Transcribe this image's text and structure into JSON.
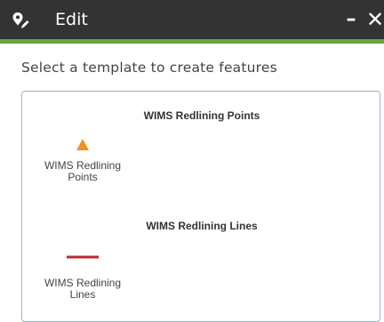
{
  "header": {
    "title": "Edit",
    "minimize_glyph": "–",
    "close_glyph": "✕",
    "background": "#333333",
    "accent": "#6aa43a"
  },
  "instructions": "Select a template to create features",
  "groups": [
    {
      "title": "WIMS Redlining Points",
      "items": [
        {
          "label": "WIMS Redlining Points",
          "symbol": "triangle-icon",
          "color": "#f0921e"
        }
      ]
    },
    {
      "title": "WIMS Redlining Lines",
      "items": [
        {
          "label": "WIMS Redlining Lines",
          "symbol": "line-icon",
          "color": "#c0272d"
        }
      ]
    }
  ]
}
